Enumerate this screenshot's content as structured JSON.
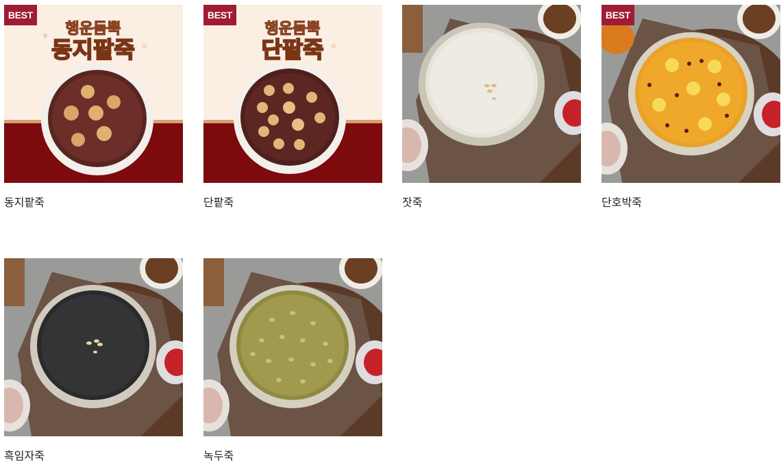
{
  "badge_text": "BEST",
  "products": [
    {
      "name": "동지팥죽",
      "best": true,
      "banner_line1": "행운듬뿍",
      "banner_line2": "동지팥죽"
    },
    {
      "name": "단팥죽",
      "best": true,
      "banner_line1": "행운듬뿍",
      "banner_line2": "단팥죽"
    },
    {
      "name": "잣죽",
      "best": false
    },
    {
      "name": "단호박죽",
      "best": true
    },
    {
      "name": "흑임자죽",
      "best": false
    },
    {
      "name": "녹두죽",
      "best": false
    }
  ]
}
